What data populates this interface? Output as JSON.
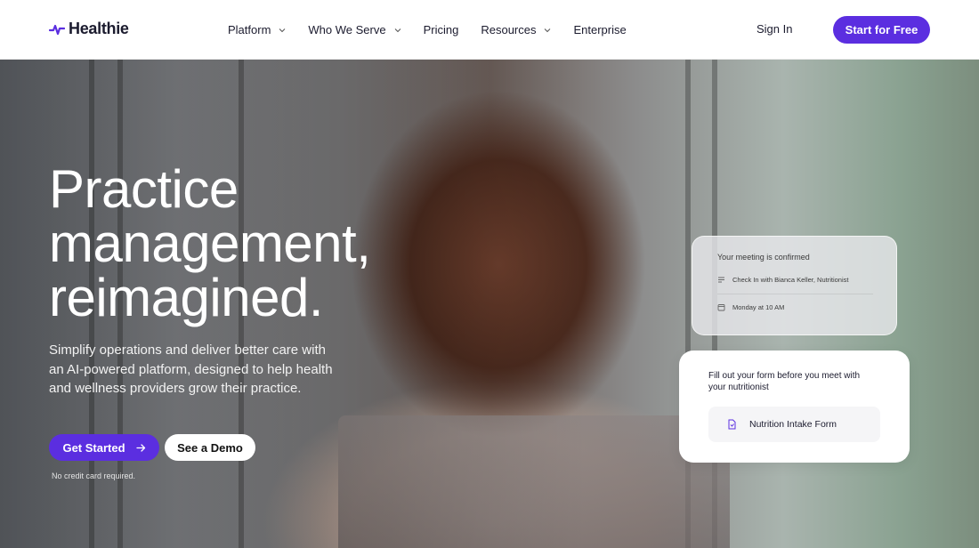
{
  "brand": {
    "name": "Healthie",
    "accent": "#5b2ee0",
    "logo_icon": "pulse-icon"
  },
  "nav": {
    "items": [
      {
        "label": "Platform",
        "has_dropdown": true
      },
      {
        "label": "Who We Serve",
        "has_dropdown": true
      },
      {
        "label": "Pricing",
        "has_dropdown": false
      },
      {
        "label": "Resources",
        "has_dropdown": true
      },
      {
        "label": "Enterprise",
        "has_dropdown": false
      }
    ],
    "sign_in": "Sign In",
    "cta": "Start for Free"
  },
  "hero": {
    "headline_lines": [
      "Practice",
      "management,",
      "reimagined."
    ],
    "subcopy": "Simplify operations and deliver better care with an AI-powered platform, designed to help health and wellness providers grow their practice.",
    "primary_button": "Get Started",
    "secondary_button": "See a Demo",
    "note": "No credit card required."
  },
  "meeting_card": {
    "title": "Your meeting is confirmed",
    "rows": [
      {
        "icon": "lines-icon",
        "text": "Check In with Bianca Keller, Nutritionist"
      },
      {
        "icon": "calendar-icon",
        "text": "Monday at 10 AM"
      }
    ]
  },
  "form_card": {
    "title": "Fill out your form before you meet with your nutritionist",
    "chip_icon": "document-icon",
    "chip_label": "Nutrition Intake Form"
  }
}
